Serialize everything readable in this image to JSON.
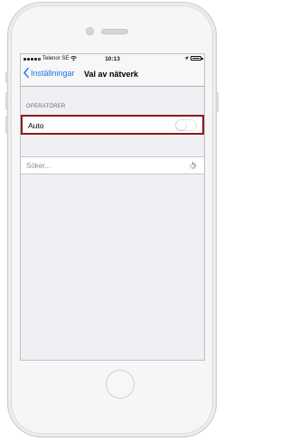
{
  "status_bar": {
    "carrier": "Telenor SE",
    "time": "10:13",
    "signal_bars_filled": 4,
    "signal_bars_total": 5,
    "location_icon": "location-arrow-icon",
    "battery_icon": "battery-icon"
  },
  "nav": {
    "back_label": "Inställningar",
    "title": "Val av nätverk",
    "back_icon": "chevron-left-icon"
  },
  "section": {
    "header": "OPERATÖRER"
  },
  "auto_row": {
    "label": "Auto",
    "toggle_on": false,
    "highlight_color": "#8b1a1a"
  },
  "search_row": {
    "label": "Söker...",
    "spinner_icon": "activity-spinner-icon"
  },
  "colors": {
    "accent": "#1a73e8",
    "background": "#efeff4"
  }
}
